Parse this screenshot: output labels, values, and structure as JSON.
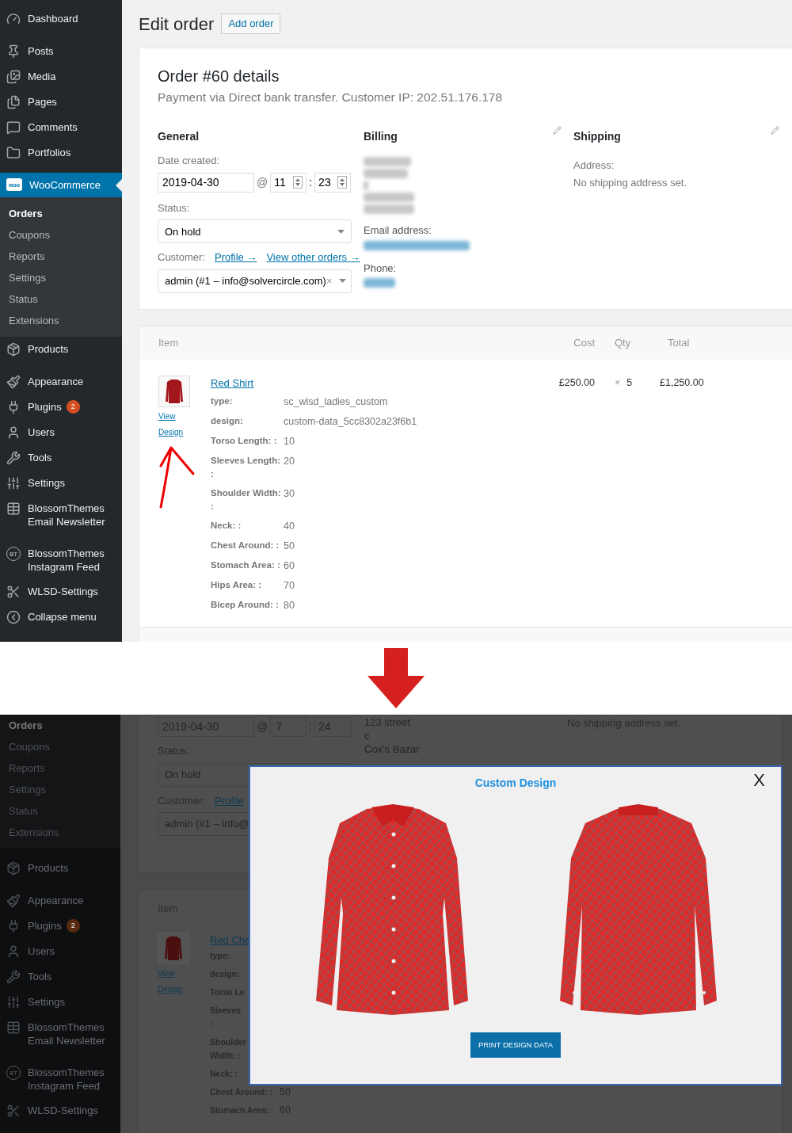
{
  "top_screen": {
    "sidebar": {
      "groups": [
        [
          {
            "kind": "dashboard",
            "label": "Dashboard",
            "selected": false
          }
        ],
        [
          {
            "kind": "posts",
            "label": "Posts",
            "selected": false
          },
          {
            "kind": "media",
            "label": "Media",
            "selected": false
          },
          {
            "kind": "pages",
            "label": "Pages",
            "selected": false
          },
          {
            "kind": "comments",
            "label": "Comments",
            "selected": false
          },
          {
            "kind": "portfolios",
            "label": "Portfolios",
            "selected": false
          }
        ],
        [
          {
            "kind": "woo",
            "label": "WooCommerce",
            "selected": true,
            "logo_text": "woo",
            "submenu": [
              {
                "label": "Orders",
                "selected": true
              },
              {
                "label": "Coupons",
                "selected": false
              },
              {
                "label": "Reports",
                "selected": false
              },
              {
                "label": "Settings",
                "selected": false
              },
              {
                "label": "Status",
                "selected": false
              },
              {
                "label": "Extensions",
                "selected": false
              }
            ]
          },
          {
            "kind": "products",
            "label": "Products",
            "selected": false
          }
        ],
        [
          {
            "kind": "appearance",
            "label": "Appearance",
            "selected": false
          },
          {
            "kind": "plugins",
            "label": "Plugins",
            "selected": false,
            "badge": "2"
          },
          {
            "kind": "users",
            "label": "Users",
            "selected": false
          },
          {
            "kind": "tools",
            "label": "Tools",
            "selected": false
          },
          {
            "kind": "settings",
            "label": "Settings",
            "selected": false
          },
          {
            "kind": "newsletter",
            "label": "BlossomThemes Email Newsletter",
            "selected": false
          }
        ],
        [
          {
            "kind": "bt",
            "label": "BlossomThemes Instagram Feed",
            "selected": false,
            "logo_text": "BT"
          },
          {
            "kind": "wlsd",
            "label": "WLSD-Settings",
            "selected": false
          },
          {
            "kind": "collapse",
            "label": "Collapse menu",
            "selected": false
          }
        ]
      ]
    },
    "header": {
      "title": "Edit order",
      "button": "Add order"
    },
    "order": {
      "title": "Order #60 details",
      "meta": "Payment via Direct bank transfer. Customer IP: 202.51.176.178",
      "general": {
        "heading": "General",
        "date_label": "Date created:",
        "date": "2019-04-30",
        "at": "@",
        "hour": "11",
        "colon": ":",
        "minute": "23",
        "status_label": "Status:",
        "status": "On hold",
        "customer_label": "Customer:",
        "links": [
          "Profile →",
          "View other orders →"
        ],
        "customer": "admin (#1 – info@solvercircle.com)",
        "clear": "×"
      },
      "billing": {
        "heading": "Billing",
        "email_label": "Email address:",
        "phone_label": "Phone:"
      },
      "shipping": {
        "heading": "Shipping",
        "address_label": "Address:",
        "address": "No shipping address set."
      }
    },
    "items": {
      "columns": [
        "Item",
        "Cost",
        "Qty",
        "Total"
      ],
      "row": {
        "name": "Red Shirt",
        "links": [
          "View",
          "Design"
        ],
        "cost": "£250.00",
        "qty_sep": "×",
        "qty": "5",
        "total": "£1,250.00",
        "meta": [
          {
            "label": "type:",
            "value": "sc_wlsd_ladies_custom"
          },
          {
            "label": "design:",
            "value": "custom-data_5cc8302a23f6b1"
          },
          {
            "label": "Torso Length: :",
            "value": "10"
          },
          {
            "label": "Sleeves Length: :",
            "value": "20"
          },
          {
            "label": "Shoulder Width: :",
            "value": "30"
          },
          {
            "label": "Neck: :",
            "value": "40"
          },
          {
            "label": "Chest Around: :",
            "value": "50"
          },
          {
            "label": "Stomach Area: :",
            "value": "60"
          },
          {
            "label": "Hips Area: :",
            "value": "70"
          },
          {
            "label": "Bicep Around: :",
            "value": "80"
          }
        ]
      }
    }
  },
  "bottom_screen": {
    "sidebar": {
      "submenu": [
        {
          "label": "Orders",
          "selected": true
        },
        {
          "label": "Coupons",
          "selected": false
        },
        {
          "label": "Reports",
          "selected": false
        },
        {
          "label": "Settings",
          "selected": false
        },
        {
          "label": "Status",
          "selected": false
        },
        {
          "label": "Extensions",
          "selected": false
        }
      ],
      "groups": [
        [
          {
            "kind": "products",
            "label": "Products"
          }
        ],
        [
          {
            "kind": "appearance",
            "label": "Appearance"
          },
          {
            "kind": "plugins",
            "label": "Plugins",
            "badge": "2"
          },
          {
            "kind": "users",
            "label": "Users"
          },
          {
            "kind": "tools",
            "label": "Tools"
          },
          {
            "kind": "settings",
            "label": "Settings"
          },
          {
            "kind": "newsletter",
            "label": "BlossomThemes Email Newsletter"
          }
        ],
        [
          {
            "kind": "bt",
            "label": "BlossomThemes Instagram Feed",
            "logo_text": "BT"
          },
          {
            "kind": "wlsd",
            "label": "WLSD-Settings"
          }
        ]
      ]
    },
    "general": {
      "date": "2019-04-30",
      "at": "@",
      "hour": "7",
      "colon": ":",
      "minute": "24",
      "status_label": "Status:",
      "status": "On hold",
      "customer_label": "Customer:",
      "link": "Profile",
      "customer": "admin (#1 – info@"
    },
    "billing_lines": [
      "123 street",
      "c",
      "Cox's Bazar"
    ],
    "shipping_address": "No shipping address set.",
    "items": {
      "column": "Item",
      "name": "Red Che",
      "links": [
        "View",
        "Design"
      ],
      "meta": [
        {
          "lines": [
            "type:"
          ]
        },
        {
          "lines": [
            "design:"
          ]
        },
        {
          "lines": [
            "Torso Le"
          ]
        },
        {
          "lines": [
            "Sleeves",
            ":"
          ]
        },
        {
          "lines": [
            "Shoulder",
            "Width: :"
          ]
        },
        {
          "lines": [
            "Neck: :"
          ]
        },
        {
          "lines": [
            "Chest Around: :"
          ],
          "value": "50"
        },
        {
          "lines": [
            "Stomach Area: :"
          ],
          "value": "60"
        }
      ]
    },
    "modal": {
      "title": "Custom Design",
      "close": "X",
      "views": [
        {
          "kind": "front"
        },
        {
          "kind": "back"
        }
      ],
      "button": "PRINT DESIGN DATA"
    }
  }
}
